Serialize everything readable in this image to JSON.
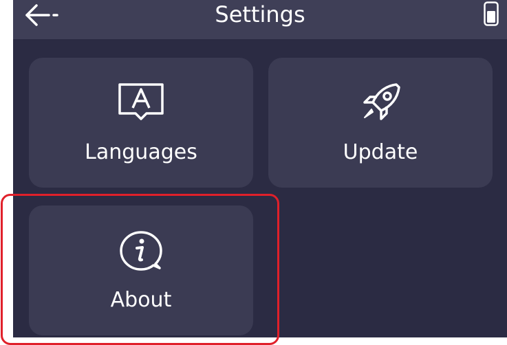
{
  "header": {
    "title": "Settings",
    "back_icon": "arrow-left-icon",
    "battery_icon": "battery-icon"
  },
  "tiles": [
    {
      "label": "Languages",
      "icon": "language-icon"
    },
    {
      "label": "Update",
      "icon": "rocket-icon"
    },
    {
      "label": "About",
      "icon": "info-icon"
    }
  ],
  "colors": {
    "background": "#2b2b43",
    "header": "#3f3f57",
    "tile": "#3b3b53",
    "text": "#ffffff",
    "highlight": "#e0202a"
  }
}
